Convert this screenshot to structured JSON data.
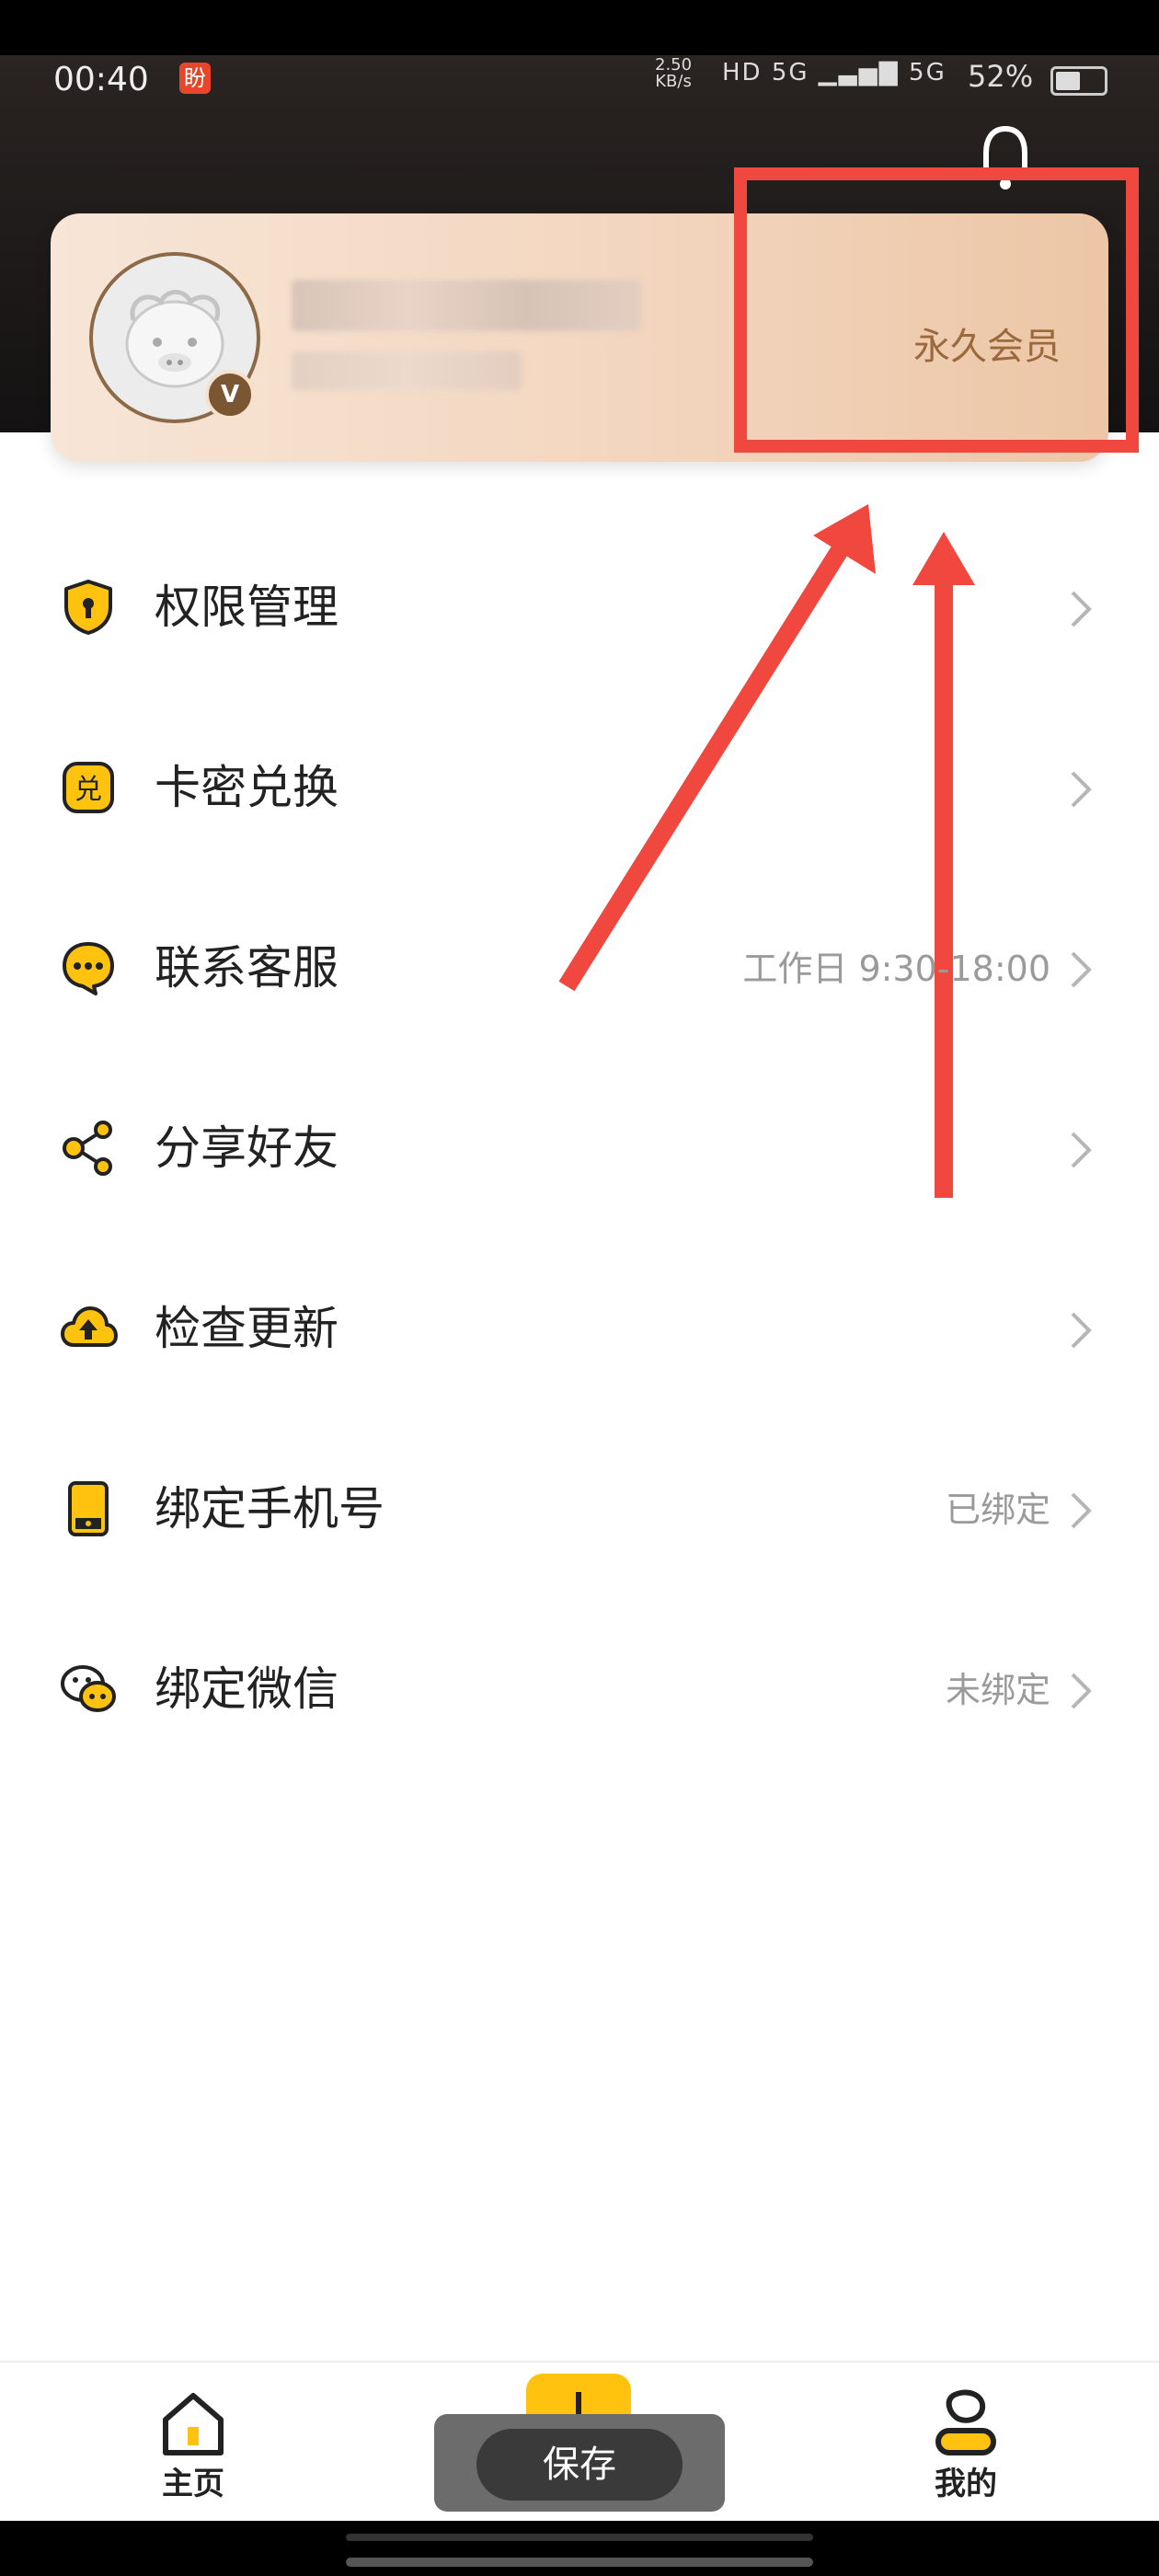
{
  "status_bar": {
    "time": "00:40",
    "app_badge": "盼",
    "net_speed": "2.50",
    "net_unit": "KB/s",
    "signal": "HD 5G ▁▃▅▇ 5G",
    "battery": "52%"
  },
  "profile": {
    "member_status": "永久会员",
    "badge": "V"
  },
  "menu": {
    "items": [
      {
        "label": "权限管理",
        "value": "",
        "icon": "shield-icon"
      },
      {
        "label": "卡密兑换",
        "value": "",
        "icon": "redeem-icon"
      },
      {
        "label": "联系客服",
        "value": "工作日 9:30-18:00",
        "icon": "chat-icon"
      },
      {
        "label": "分享好友",
        "value": "",
        "icon": "share-icon"
      },
      {
        "label": "检查更新",
        "value": "",
        "icon": "cloud-upload-icon"
      },
      {
        "label": "绑定手机号",
        "value": "已绑定",
        "icon": "phone-icon"
      },
      {
        "label": "绑定微信",
        "value": "未绑定",
        "icon": "wechat-icon"
      }
    ]
  },
  "bottom_nav": {
    "home_label": "主页",
    "mine_label": "我的"
  },
  "toast": {
    "save_label": "保存"
  },
  "colors": {
    "accent": "#ffc20e",
    "member_text": "#9a6a3c",
    "annotation": "#f0473f"
  }
}
